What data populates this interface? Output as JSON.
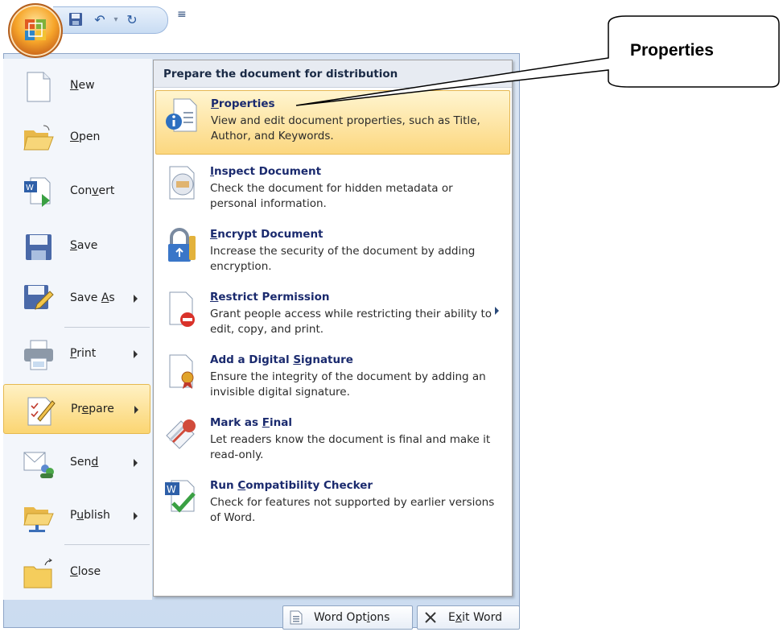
{
  "qat": {
    "save_icon": "save-icon",
    "undo_icon": "undo-icon",
    "redo_icon": "redo-icon",
    "customize": "≡"
  },
  "left_menu": {
    "items": [
      {
        "pre": "",
        "key": "N",
        "post": "ew",
        "icon": "new-document-icon",
        "arrow": false
      },
      {
        "pre": "",
        "key": "O",
        "post": "pen",
        "icon": "open-folder-icon",
        "arrow": false
      },
      {
        "pre": "Con",
        "key": "v",
        "post": "ert",
        "icon": "convert-icon",
        "arrow": false
      },
      {
        "pre": "",
        "key": "S",
        "post": "ave",
        "icon": "save-icon",
        "arrow": false
      },
      {
        "pre": "Save ",
        "key": "A",
        "post": "s",
        "icon": "save-as-icon",
        "arrow": true
      },
      {
        "pre": "",
        "key": "P",
        "post": "rint",
        "icon": "print-icon",
        "arrow": true
      },
      {
        "pre": "Pr",
        "key": "e",
        "post": "pare",
        "icon": "prepare-icon",
        "arrow": true
      },
      {
        "pre": "Sen",
        "key": "d",
        "post": "",
        "icon": "send-icon",
        "arrow": true
      },
      {
        "pre": "P",
        "key": "u",
        "post": "blish",
        "icon": "publish-icon",
        "arrow": true
      },
      {
        "pre": "",
        "key": "C",
        "post": "lose",
        "icon": "close-folder-icon",
        "arrow": false
      }
    ]
  },
  "prepare_panel": {
    "header": "Prepare the document for distribution",
    "items": [
      {
        "pre": "",
        "key": "P",
        "post": "roperties",
        "desc": "View and edit document properties, such as Title, Author, and Keywords.",
        "icon": "properties-icon"
      },
      {
        "pre": "",
        "key": "I",
        "post": "nspect Document",
        "desc": "Check the document for hidden metadata or personal information.",
        "icon": "inspect-document-icon"
      },
      {
        "pre": "",
        "key": "E",
        "post": "ncrypt Document",
        "desc": "Increase the security of the document by adding encryption.",
        "icon": "encrypt-lock-icon"
      },
      {
        "pre": "",
        "key": "R",
        "post": "estrict Permission",
        "desc": "Grant people access while restricting their ability to edit, copy, and print.",
        "icon": "restrict-permission-icon"
      },
      {
        "pre": "Add a Digital ",
        "key": "S",
        "post": "ignature",
        "desc": "Ensure the integrity of the document by adding an invisible digital signature.",
        "icon": "digital-signature-icon"
      },
      {
        "pre": "Mark as ",
        "key": "F",
        "post": "inal",
        "desc": "Let readers know the document is final and make it read-only.",
        "icon": "mark-as-final-icon"
      },
      {
        "pre": "Run ",
        "key": "C",
        "post": "ompatibility Checker",
        "desc": "Check for features not supported by earlier versions of Word.",
        "icon": "compatibility-checker-icon"
      }
    ]
  },
  "footer": {
    "word_options": {
      "pre": "Word Opt",
      "key": "i",
      "post": "ons"
    },
    "exit_word": {
      "pre": "E",
      "key": "x",
      "post": "it Word"
    }
  },
  "callout": {
    "text": "Properties"
  }
}
